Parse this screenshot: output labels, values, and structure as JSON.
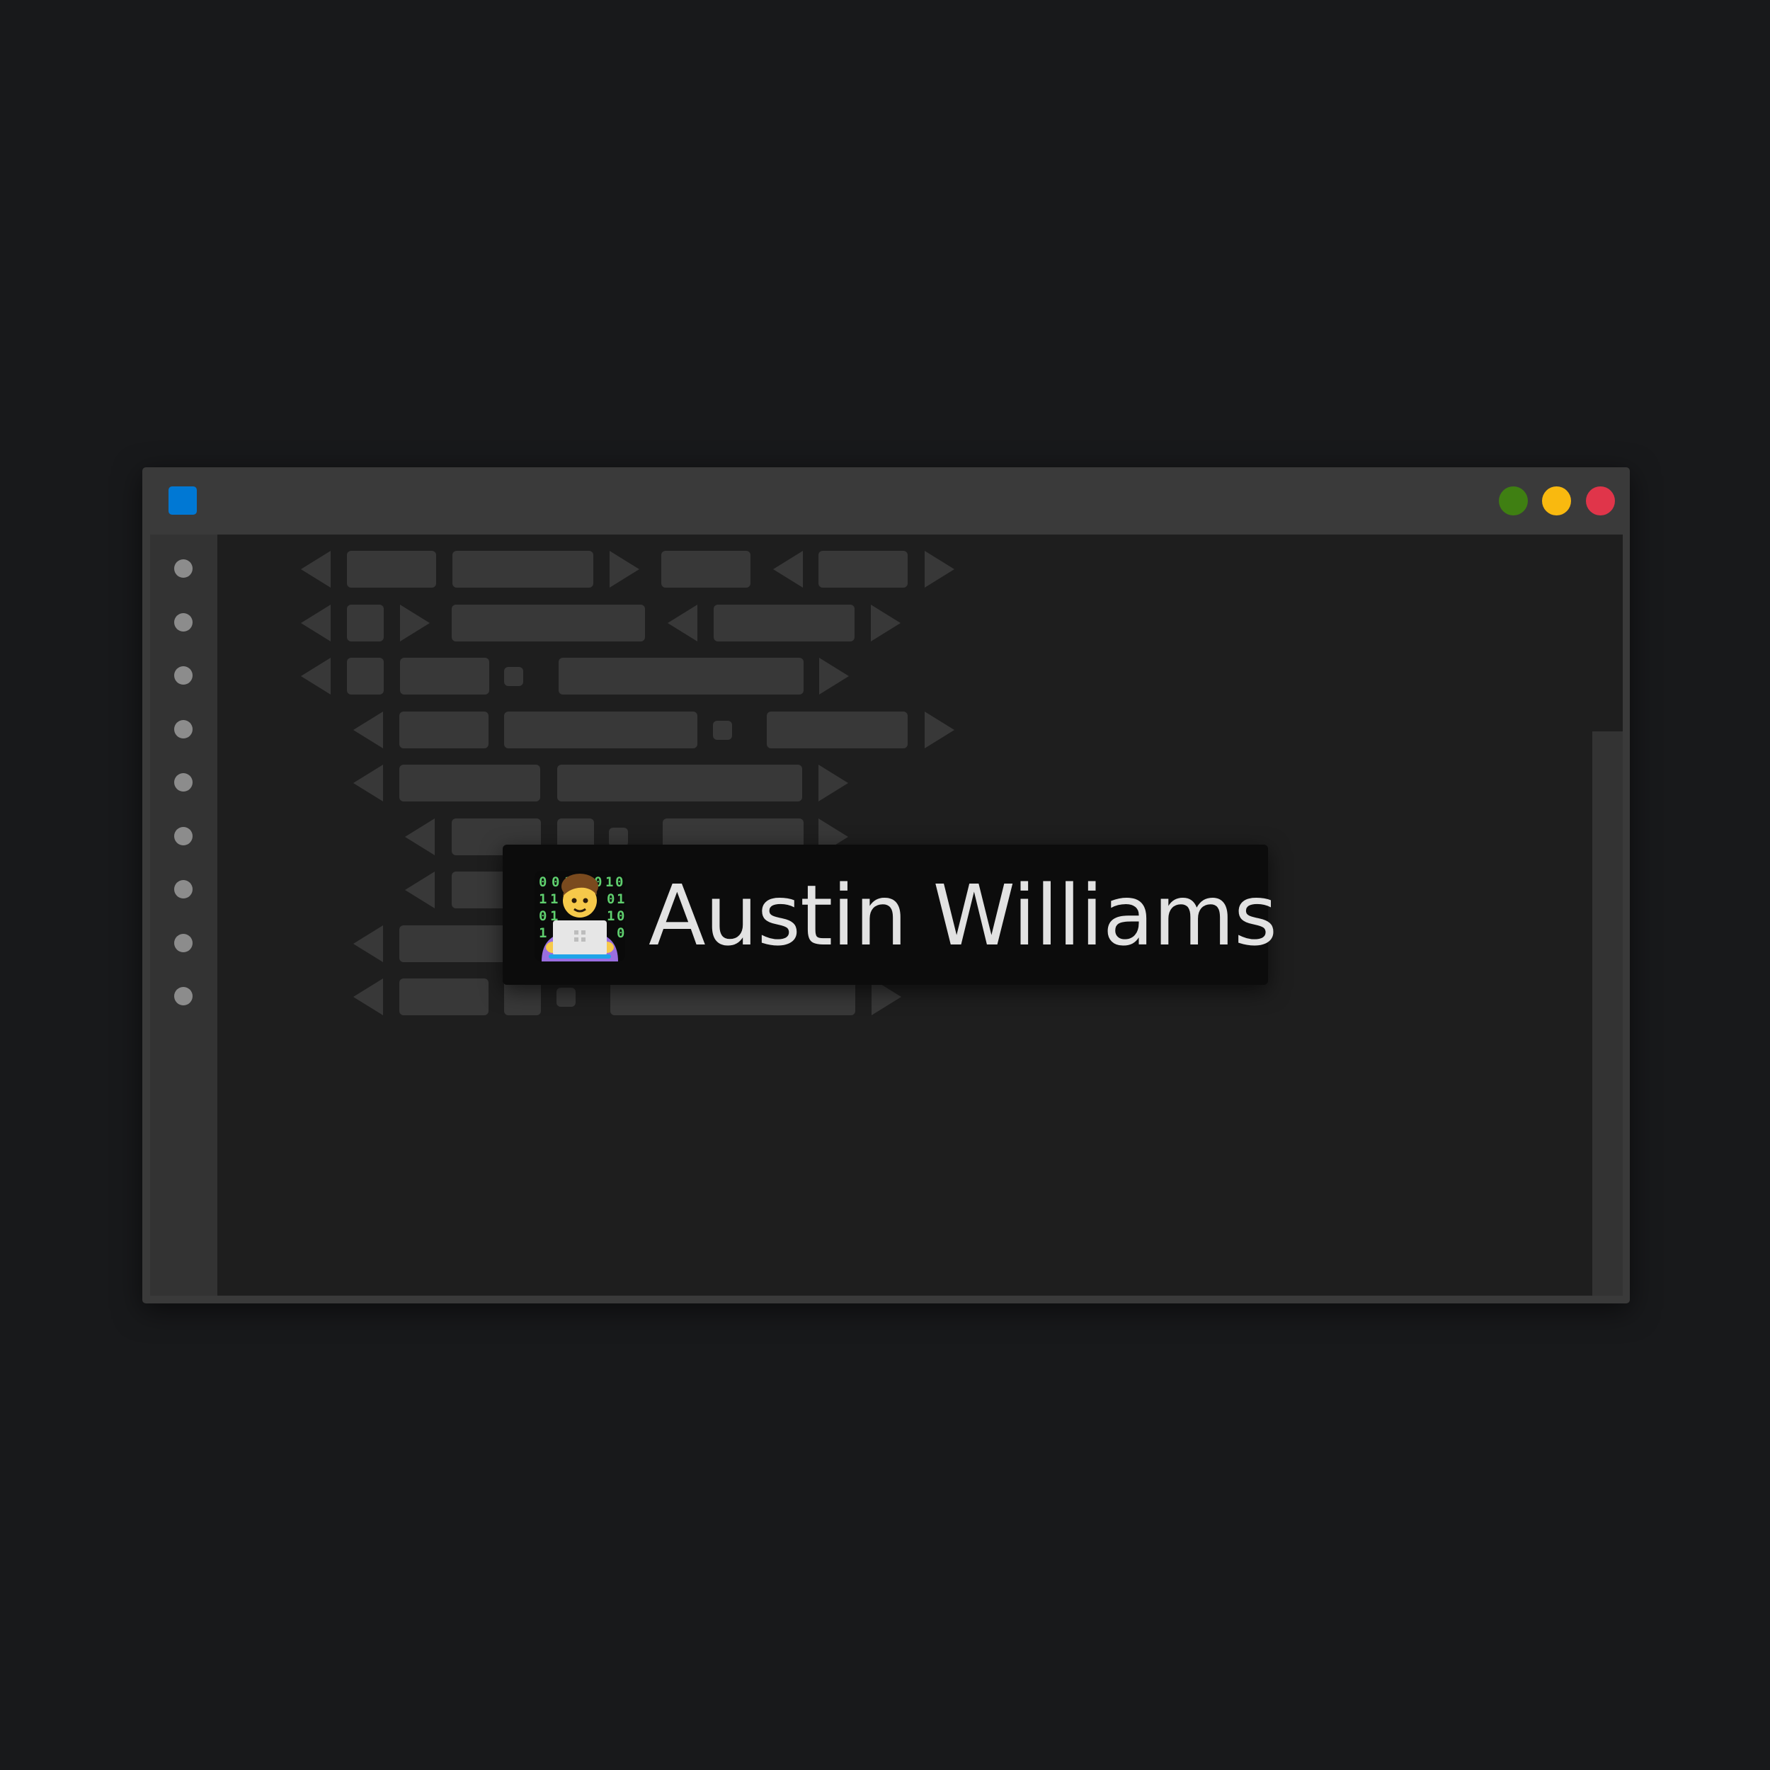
{
  "window": {
    "app_icon": "app-icon",
    "controls": [
      {
        "name": "maximize",
        "color": "#3f7f12"
      },
      {
        "name": "minimize",
        "color": "#f9b90f"
      },
      {
        "name": "close",
        "color": "#e0354a"
      }
    ]
  },
  "sidebar": {
    "items": [
      "dot",
      "dot",
      "dot",
      "dot",
      "dot",
      "dot",
      "dot",
      "dot",
      "dot"
    ]
  },
  "toast": {
    "avatar_icon": "technologist-icon",
    "name": "Austin Williams"
  },
  "colors": {
    "background": "#18191b",
    "window": "#3a3a3a",
    "editor": "#1e1e1e",
    "placeholder": "#383838",
    "accent": "#0078d4",
    "toast_bg": "#0c0c0c",
    "toast_text": "#e2e2e2"
  }
}
